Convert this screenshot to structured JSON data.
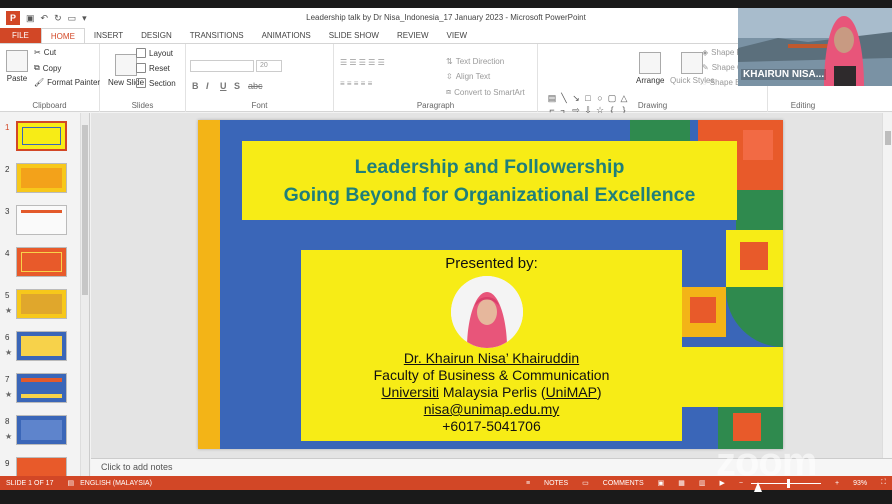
{
  "window": {
    "title": "Leadership talk by Dr Nisa_Indonesia_17 January 2023 - Microsoft PowerPoint"
  },
  "ribbon_tabs": [
    {
      "label": "FILE"
    },
    {
      "label": "HOME"
    },
    {
      "label": "INSERT"
    },
    {
      "label": "DESIGN"
    },
    {
      "label": "TRANSITIONS"
    },
    {
      "label": "ANIMATIONS"
    },
    {
      "label": "SLIDE SHOW"
    },
    {
      "label": "REVIEW"
    },
    {
      "label": "VIEW"
    }
  ],
  "ribbon": {
    "clipboard": {
      "paste": "Paste",
      "cut": "Cut",
      "copy": "Copy",
      "format_painter": "Format Painter",
      "label": "Clipboard"
    },
    "slides": {
      "new_slide": "New Slide",
      "layout": "Layout",
      "reset": "Reset",
      "section": "Section",
      "label": "Slides"
    },
    "font": {
      "size": "20",
      "bold": "B",
      "italic": "I",
      "underline": "U",
      "shadow": "S",
      "strike": "abc",
      "label": "Font"
    },
    "paragraph": {
      "text_direction": "Text Direction",
      "align_text": "Align Text",
      "smartart": "Convert to SmartArt",
      "label": "Paragraph"
    },
    "drawing": {
      "arrange": "Arrange",
      "quick_styles": "Quick Styles",
      "shape_fill": "Shape F",
      "shape_outline": "Shape O",
      "shape_effects": "Shape E",
      "label": "Drawing"
    },
    "editing": {
      "label": "Editing"
    }
  },
  "thumbnails": [
    {
      "num": "1",
      "star": ""
    },
    {
      "num": "2",
      "star": ""
    },
    {
      "num": "3",
      "star": ""
    },
    {
      "num": "4",
      "star": ""
    },
    {
      "num": "5",
      "star": "★"
    },
    {
      "num": "6",
      "star": "★"
    },
    {
      "num": "7",
      "star": "★"
    },
    {
      "num": "8",
      "star": "★"
    },
    {
      "num": "9",
      "star": ""
    }
  ],
  "slide": {
    "title_line1": "Leadership and Followership",
    "title_line2": "Going Beyond for Organizational Excellence",
    "presented_by": "Presented by:",
    "name": "Dr. Khairun Nisa’ Khairuddin",
    "faculty": "Faculty of Business & Communication",
    "univ_a": "Universiti",
    "univ_b": " Malaysia Perlis (",
    "univ_c": "UniMAP",
    "univ_d": ")",
    "email": "nisa@unimap.edu.my",
    "phone": "+6017-5041706"
  },
  "notes_placeholder": "Click to add notes",
  "status": {
    "slide": "SLIDE 1 OF 17",
    "language": "ENGLISH (MALAYSIA)",
    "notes": "NOTES",
    "comments": "COMMENTS",
    "zoom": "93%"
  },
  "video": {
    "participant": "KHAIRUN NISA..."
  },
  "zoom_watermark": "zoom",
  "colors": {
    "accent": "#d24726",
    "slide_yellow": "#f7ec16",
    "slide_blue": "#3a66b8",
    "title_teal": "#1f7f7a"
  }
}
